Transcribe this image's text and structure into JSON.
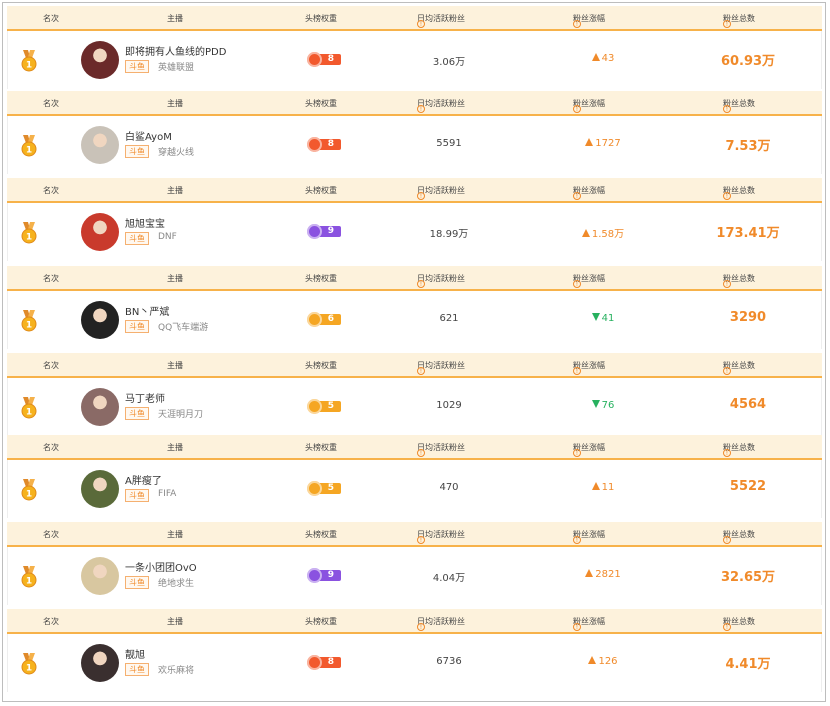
{
  "header": {
    "rank": "名次",
    "anchor": "主播",
    "weight": "头榜权重",
    "daily_active": "日均活跃粉丝",
    "growth": "粉丝涨幅",
    "total": "粉丝总数"
  },
  "rows": [
    {
      "name": "即将拥有人鱼线的PDD",
      "platform": "斗鱼",
      "game": "英雄联盟",
      "weight": "8",
      "weight_color": "#f2592d",
      "daily": "3.06万",
      "growth": "43",
      "growth_dir": "up",
      "total": "60.93万",
      "avatar_color": "#6b2a2a"
    },
    {
      "name": "白鲨AyoM",
      "platform": "斗鱼",
      "game": "穿越火线",
      "weight": "8",
      "weight_color": "#f2592d",
      "daily": "5591",
      "growth": "1727",
      "growth_dir": "up",
      "total": "7.53万",
      "avatar_color": "#c9c2b8"
    },
    {
      "name": "旭旭宝宝",
      "platform": "斗鱼",
      "game": "DNF",
      "weight": "9",
      "weight_color": "#8a52e0",
      "daily": "18.99万",
      "growth": "1.58万",
      "growth_dir": "up",
      "total": "173.41万",
      "avatar_color": "#c93a2c"
    },
    {
      "name": "BN丶严斌",
      "platform": "斗鱼",
      "game": "QQ飞车端游",
      "weight": "6",
      "weight_color": "#f5a623",
      "daily": "621",
      "growth": "41",
      "growth_dir": "down",
      "total": "3290",
      "avatar_color": "#222222"
    },
    {
      "name": "马丁老师",
      "platform": "斗鱼",
      "game": "天涯明月刀",
      "weight": "5",
      "weight_color": "#f5a623",
      "daily": "1029",
      "growth": "76",
      "growth_dir": "down",
      "total": "4564",
      "avatar_color": "#8a6a66"
    },
    {
      "name": "A胖瘦了",
      "platform": "斗鱼",
      "game": "FIFA",
      "weight": "5",
      "weight_color": "#f5a623",
      "daily": "470",
      "growth": "11",
      "growth_dir": "up",
      "total": "5522",
      "avatar_color": "#5a6a3a"
    },
    {
      "name": "一条小团团OvO",
      "platform": "斗鱼",
      "game": "绝地求生",
      "weight": "9",
      "weight_color": "#8a52e0",
      "daily": "4.04万",
      "growth": "2821",
      "growth_dir": "up",
      "total": "32.65万",
      "avatar_color": "#d8c7a0"
    },
    {
      "name": "靓旭",
      "platform": "斗鱼",
      "game": "欢乐麻将",
      "weight": "8",
      "weight_color": "#f2592d",
      "daily": "6736",
      "growth": "126",
      "growth_dir": "up",
      "total": "4.41万",
      "avatar_color": "#3a2f2f"
    }
  ]
}
